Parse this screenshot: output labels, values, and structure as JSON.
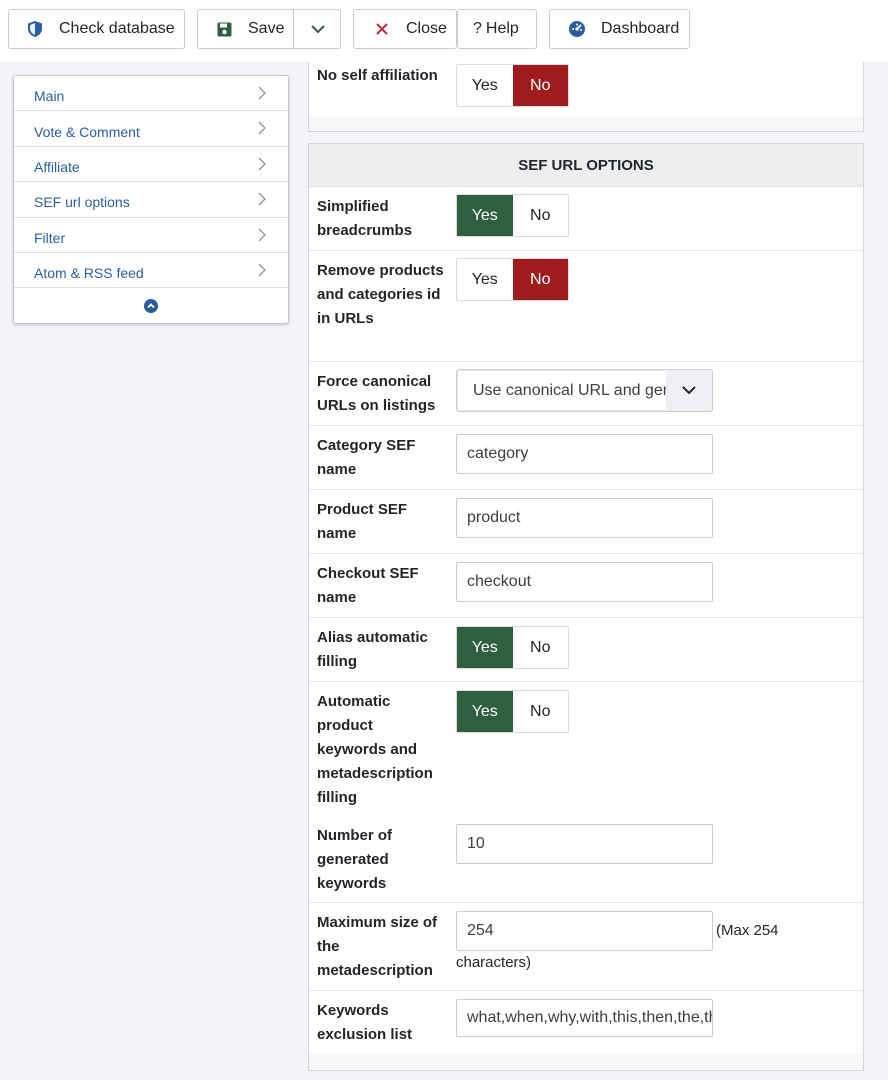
{
  "toolbar": {
    "check_database": "Check database",
    "save": "Save",
    "close": "Close",
    "help": "Help",
    "dashboard": "Dashboard",
    "colors": {
      "check_icon": "#2a5d9f",
      "save_icon": "#2f5f3c",
      "close_icon": "#c8202e",
      "dashboard_icon": "#2a5d9f"
    }
  },
  "sidebar": {
    "items": [
      {
        "label": "Main"
      },
      {
        "label": "Vote & Comment"
      },
      {
        "label": "Affiliate"
      },
      {
        "label": "SEF url options"
      },
      {
        "label": "Filter"
      },
      {
        "label": "Atom & RSS feed"
      }
    ],
    "collapse_icon": "chevron-up-circle-icon"
  },
  "top_section": {
    "no_self_affiliation": {
      "label": "No self affiliation",
      "yes": "Yes",
      "no": "No",
      "value": "No"
    }
  },
  "sef": {
    "title": "SEF URL OPTIONS",
    "simplified_breadcrumbs": {
      "label": "Simplified breadcrumbs",
      "yes": "Yes",
      "no": "No",
      "value": "Yes"
    },
    "remove_ids": {
      "label": "Remove products and categories id in URLs",
      "yes": "Yes",
      "no": "No",
      "value": "No"
    },
    "force_canonical": {
      "label": "Force canonical URLs on listings",
      "value": "Use canonical URL and gen"
    },
    "category_sef": {
      "label": "Category SEF name",
      "value": "category"
    },
    "product_sef": {
      "label": "Product SEF name",
      "value": "product"
    },
    "checkout_sef": {
      "label": "Checkout SEF name",
      "value": "checkout"
    },
    "alias_filling": {
      "label": "Alias automatic filling",
      "yes": "Yes",
      "no": "No",
      "value": "Yes"
    },
    "auto_keywords": {
      "label": "Automatic product keywords and metadescription filling",
      "yes": "Yes",
      "no": "No",
      "value": "Yes"
    },
    "num_keywords": {
      "label": "Number of generated keywords",
      "value": "10"
    },
    "max_meta": {
      "label": "Maximum size of the metadescription",
      "value": "254",
      "hint_a": "(Max 254",
      "hint_b": "characters)"
    },
    "keywords_exclusion": {
      "label": "Keywords exclusion list",
      "value": "what,when,why,with,this,then,the,th"
    }
  },
  "colors": {
    "yes_active": "#2f5f3c",
    "no_active": "#a01c1c",
    "link": "#2a5d9f"
  }
}
